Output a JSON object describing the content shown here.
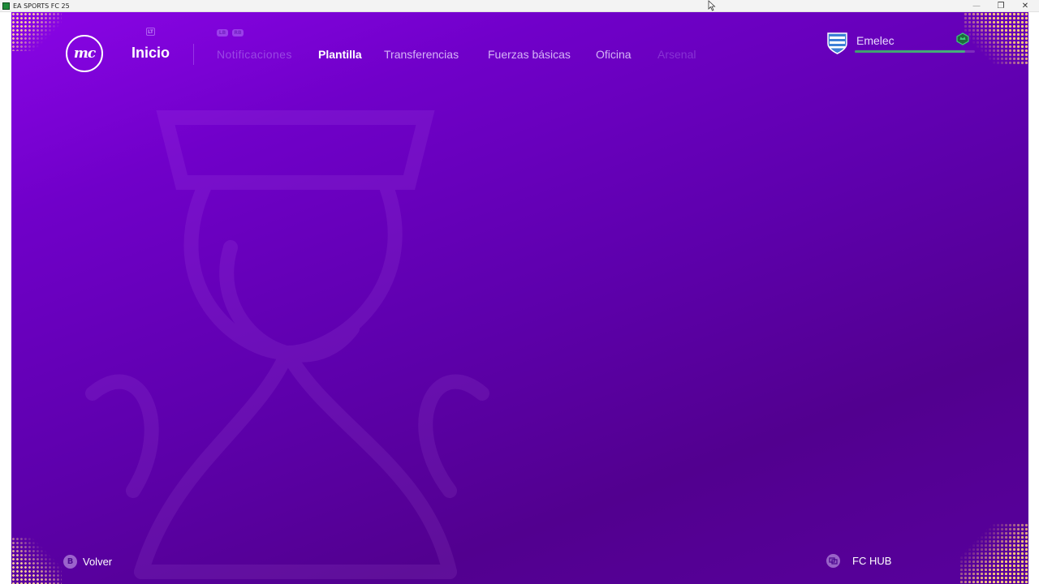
{
  "window": {
    "title": "EA SPORTS FC 25",
    "minimize": "—",
    "maximize": "❐",
    "close": "✕"
  },
  "logo": {
    "text": "mc"
  },
  "nav": {
    "home_label": "Inicio",
    "home_hint": "LT",
    "shoulder_left": "LB",
    "shoulder_right": "RB",
    "tabs": [
      {
        "label": "Notificaciones",
        "state": "disabled"
      },
      {
        "label": "Plantilla",
        "state": "selected"
      },
      {
        "label": "Transferencias",
        "state": "normal"
      },
      {
        "label": "Fuerzas básicas",
        "state": "normal"
      },
      {
        "label": "Oficina",
        "state": "normal"
      },
      {
        "label": "Arsenal",
        "state": "faded"
      }
    ]
  },
  "club": {
    "name": "Emelec",
    "progress_percent": 92,
    "accent_color": "#46b07a"
  },
  "footer": {
    "back_glyph": "B",
    "back_label": "Volver",
    "hub_label": "FC HUB"
  },
  "colors": {
    "background_top": "#8a05e6",
    "background_bottom": "#52008f",
    "corner_dots": "#ffcd78"
  }
}
